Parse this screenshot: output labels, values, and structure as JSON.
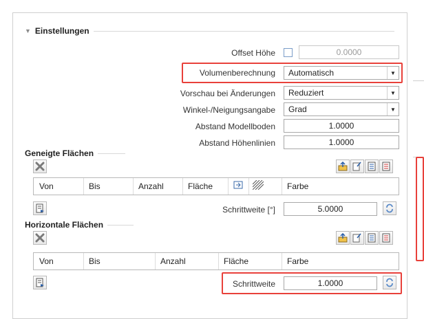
{
  "section_settings": {
    "title": "Einstellungen",
    "offset_label": "Offset Höhe",
    "offset_value": "0.0000",
    "volumen_label": "Volumenberechnung",
    "volumen_value": "Automatisch",
    "vorschau_label": "Vorschau bei Änderungen",
    "vorschau_value": "Reduziert",
    "winkel_label": "Winkel-/Neigungsangabe",
    "winkel_value": "Grad",
    "modellboden_label": "Abstand Modellboden",
    "modellboden_value": "1.0000",
    "hoehenlinien_label": "Abstand Höhenlinien",
    "hoehenlinien_value": "1.0000"
  },
  "geneigte": {
    "title": "Geneigte Flächen",
    "columns": [
      "Von",
      "Bis",
      "Anzahl",
      "Fläche",
      "Farbe"
    ],
    "step_label": "Schrittweite [°]",
    "step_value": "5.0000"
  },
  "horizontale": {
    "title": "Horizontale Flächen",
    "columns": [
      "Von",
      "Bis",
      "Anzahl",
      "Fläche",
      "Farbe"
    ],
    "step_label": "Schrittweite",
    "step_value": "1.0000"
  },
  "colors": {
    "highlight": "#e8403a",
    "checkbox_border": "#7a9cc8"
  },
  "icons": [
    "delete-icon",
    "export-icon",
    "import-icon",
    "table-icon",
    "table-red-icon",
    "apply-icon",
    "refresh-icon",
    "pin-icon",
    "hatch-icon"
  ]
}
